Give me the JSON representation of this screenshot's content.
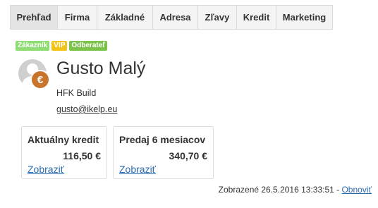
{
  "tabs": [
    {
      "label": "Prehľad",
      "active": true
    },
    {
      "label": "Firma"
    },
    {
      "label": "Základné"
    },
    {
      "label": "Adresa"
    },
    {
      "label": "Zľavy"
    },
    {
      "label": "Kredit"
    },
    {
      "label": "Marketing"
    }
  ],
  "badges": [
    {
      "label": "Zákazník",
      "color": "#8fdc73"
    },
    {
      "label": "VIP",
      "color": "#f0c419"
    },
    {
      "label": "Odberateľ",
      "color": "#7cc34a"
    }
  ],
  "customer": {
    "name": "Gusto Malý",
    "company": "HFK Build",
    "email": "gusto@ikelp.eu",
    "avatar_icon": "user-avatar-icon",
    "euro_icon": "€"
  },
  "cards": [
    {
      "title": "Aktuálny kredit",
      "value": "116,50 €",
      "link": "Zobraziť"
    },
    {
      "title": "Predaj 6 mesiacov",
      "value": "340,70 €",
      "link": "Zobraziť"
    }
  ],
  "footer": {
    "displayed_text": "Zobrazené 26.5.2016 13:33:51 - ",
    "refresh_label": "Obnoviť"
  },
  "colors": {
    "link": "#2a6ab0",
    "tab_active_bg": "#e4e4e4",
    "euro_badge": "#c8742a"
  }
}
